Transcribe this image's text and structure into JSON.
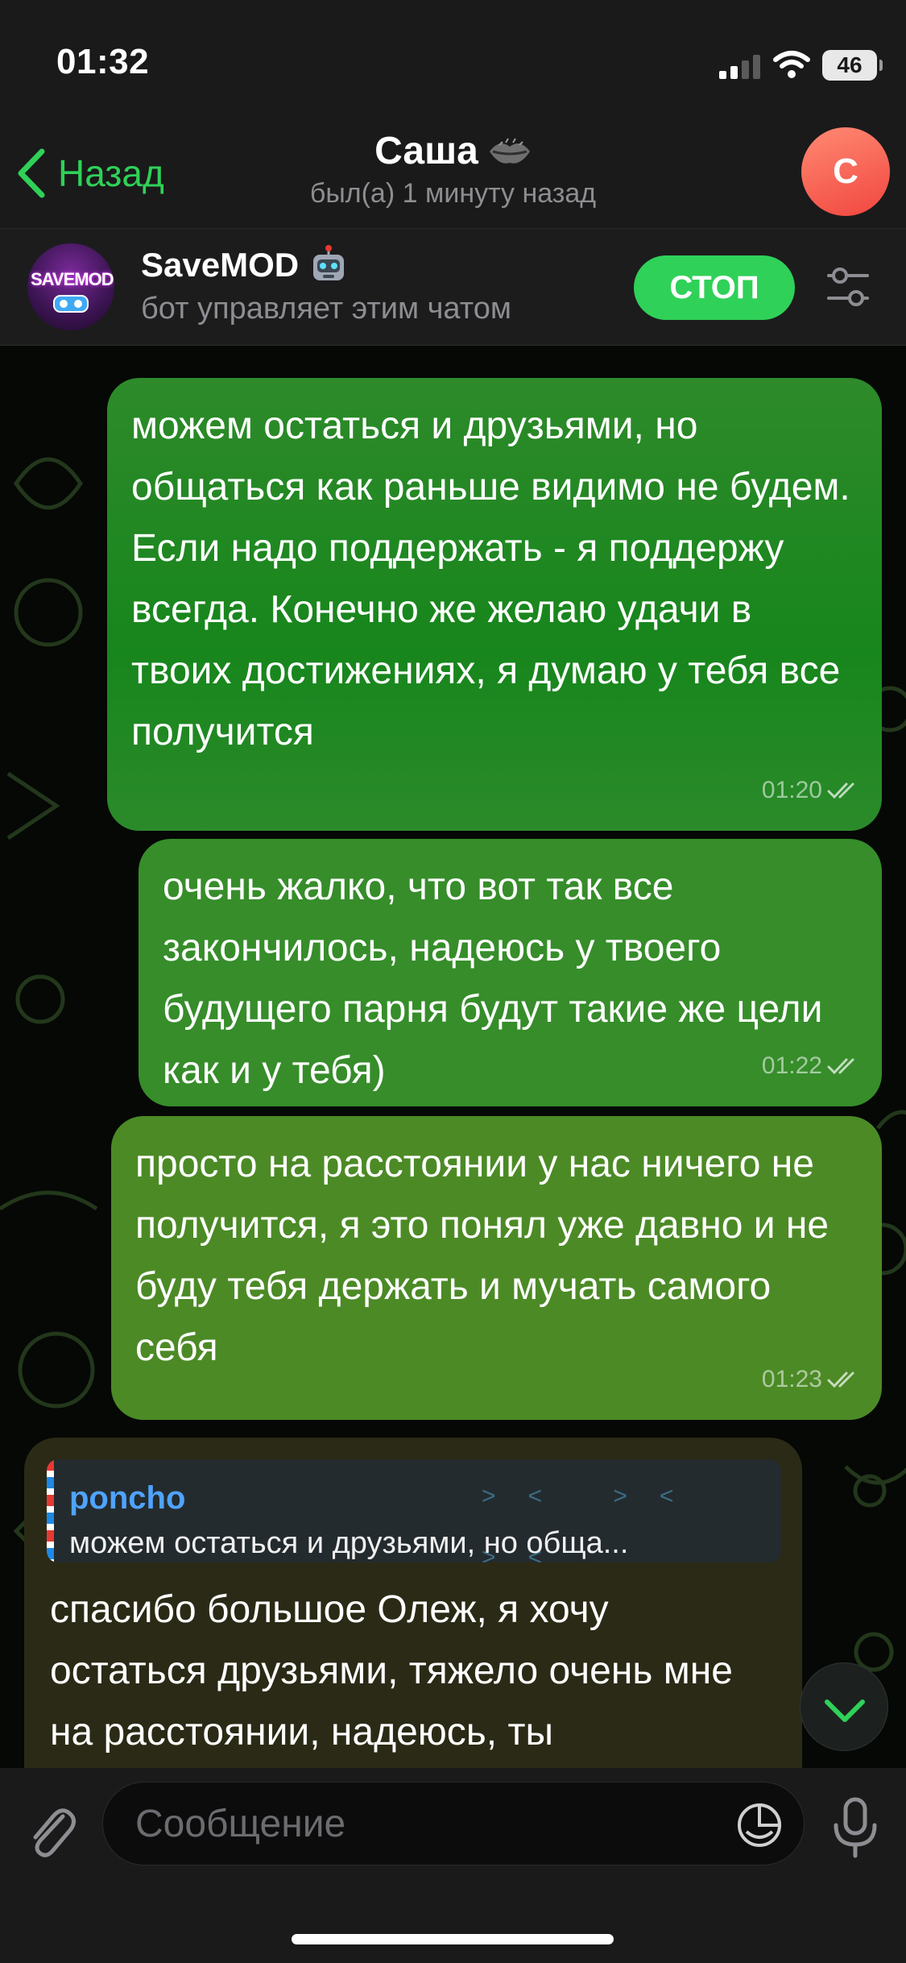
{
  "status_bar": {
    "time": "01:32",
    "battery": "46"
  },
  "nav": {
    "back_label": "Назад",
    "title": "Саша",
    "subtitle": "был(а) 1 минуту назад",
    "avatar_letter": "С",
    "avatar_colors": [
      "#ff8a73",
      "#f1463f"
    ]
  },
  "bot_banner": {
    "name": "SaveMOD",
    "description": "бот управляет этим чатом",
    "stop_label": "СТОП",
    "avatar_text": "SAVEMOD"
  },
  "messages": [
    {
      "text": "можем остаться и друзьями, но общаться как раньше видимо не будем. Если надо поддержать - я поддержу всегда. Конечно же желаю удачи в твоих достижениях, я думаю у тебя все получится",
      "time": "01:20",
      "outgoing": true
    },
    {
      "text": "очень жалко, что вот так все закончилось, надеюсь у твоего будущего парня будут такие же цели как и у тебя)",
      "time": "01:22",
      "outgoing": true
    },
    {
      "text": "просто на расстоянии у нас ничего не получится, я это понял уже давно и не буду тебя держать и мучать самого себя",
      "time": "01:23",
      "outgoing": true
    },
    {
      "reply_name": "poncho",
      "reply_text": "можем остаться и друзьями, но обща...",
      "text": "спасибо большое Олеж, я хочу остаться друзьями, тяжело очень мне на расстоянии, надеюсь, ты",
      "outgoing": false
    }
  ],
  "input": {
    "placeholder": "Сообщение"
  },
  "colors": {
    "accent": "#2fd158",
    "link": "#4fa3ff"
  }
}
